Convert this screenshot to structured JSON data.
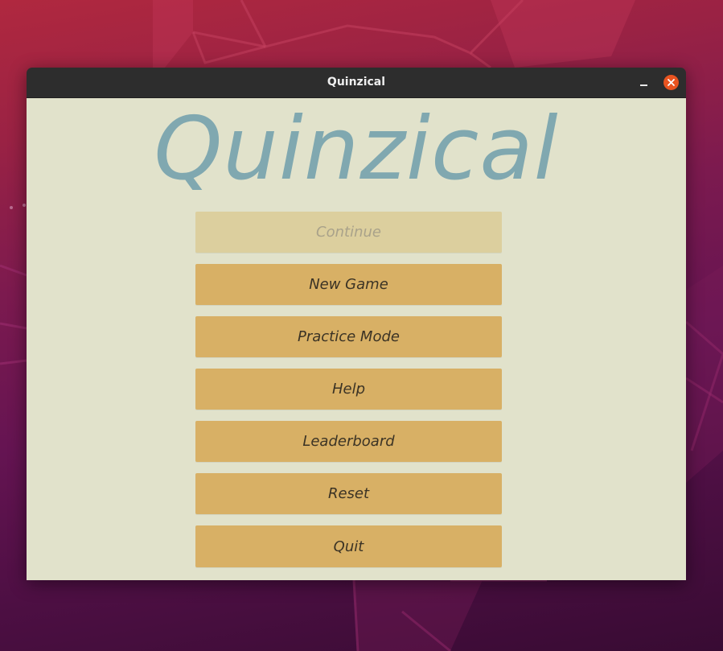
{
  "window": {
    "title": "Quinzical"
  },
  "app": {
    "heading": "Quinzical"
  },
  "menu": {
    "continue_label": "Continue",
    "new_game_label": "New Game",
    "practice_mode_label": "Practice Mode",
    "help_label": "Help",
    "leaderboard_label": "Leaderboard",
    "reset_label": "Reset",
    "quit_label": "Quit"
  },
  "colors": {
    "window_background": "#e1e2cb",
    "title_color": "#80a8b0",
    "button_background": "#d8b065",
    "button_disabled_background": "#dccf9e",
    "close_button": "#e95420"
  },
  "icons": {
    "minimize": "minimize-icon",
    "close": "close-icon"
  }
}
